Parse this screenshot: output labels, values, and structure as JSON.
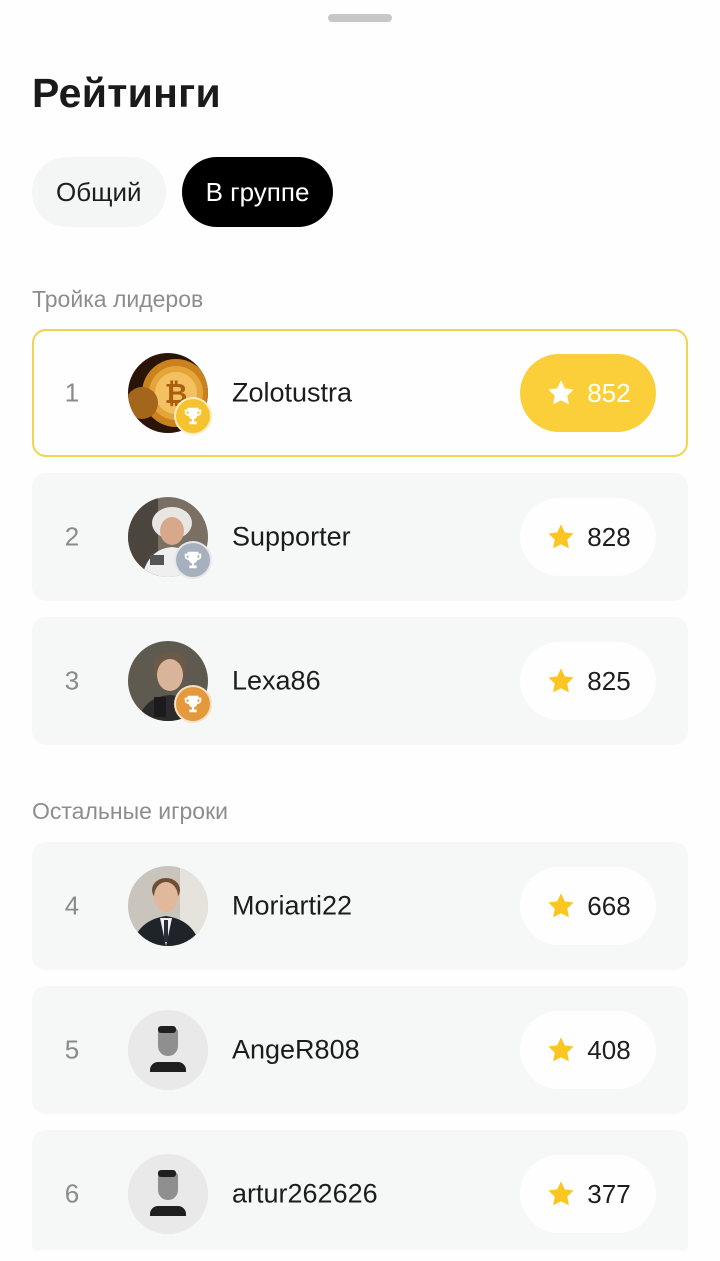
{
  "header": {
    "title": "Рейтинги"
  },
  "tabs": [
    {
      "label": "Общий",
      "active": false
    },
    {
      "label": "В группе",
      "active": true
    }
  ],
  "sections": {
    "leaders_label": "Тройка лидеров",
    "others_label": "Остальные игроки"
  },
  "leaders": [
    {
      "rank": "1",
      "name": "Zolotustra",
      "score": "852",
      "trophy": "gold",
      "avatar": "bitcoin-avatar"
    },
    {
      "rank": "2",
      "name": "Supporter",
      "score": "828",
      "trophy": "silver",
      "avatar": "photo-avatar"
    },
    {
      "rank": "3",
      "name": "Lexa86",
      "score": "825",
      "trophy": "bronze",
      "avatar": "photo-avatar"
    }
  ],
  "others": [
    {
      "rank": "4",
      "name": "Moriarti22",
      "score": "668",
      "avatar": "photo-avatar"
    },
    {
      "rank": "5",
      "name": "AngeR808",
      "score": "408",
      "avatar": "default-user-avatar"
    },
    {
      "rank": "6",
      "name": "artur262626",
      "score": "377",
      "avatar": "default-user-avatar"
    }
  ],
  "colors": {
    "accent_yellow": "#fbcf3a",
    "star": "#f9c623",
    "gold_border": "#f0d34f",
    "active_tab": "#000000",
    "row_bg": "#f6f7f7",
    "muted_text": "#8d8d8d"
  }
}
